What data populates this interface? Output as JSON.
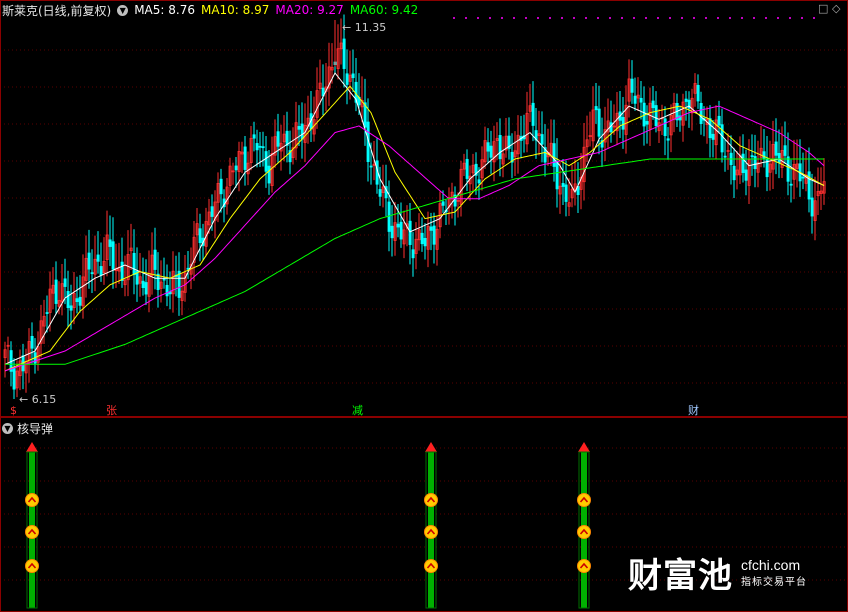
{
  "header": {
    "stock": "斯莱克(日线,前复权)",
    "ma5": "MA5: 8.76",
    "ma10": "MA10: 8.97",
    "ma20": "MA20: 9.27",
    "ma60": "MA60: 9.42"
  },
  "sub_title": "核导弹",
  "corner_icons": [
    "square-icon",
    "diamond-icon"
  ],
  "colors": {
    "up": "#ff3030",
    "down": "#00ffff",
    "ma5": "#ffffff",
    "ma10": "#ffff00",
    "ma20": "#ff00ff",
    "ma60": "#00ff00",
    "missile": "#00b000"
  },
  "chart_data": {
    "type": "candlestick",
    "ylim": [
      5.8,
      11.6
    ],
    "high_label": "11.35",
    "low_label": "6.15",
    "markers": [
      {
        "text": "$",
        "x": 2,
        "color": "#ff3030"
      },
      {
        "text": "张",
        "x": 34,
        "color": "#ff3030"
      },
      {
        "text": "减",
        "x": 116,
        "color": "#00ff00"
      },
      {
        "text": "财",
        "x": 228,
        "color": "#a0c8ff"
      }
    ],
    "missiles": [
      9,
      142,
      193
    ],
    "trend": [
      [
        0,
        6.5
      ],
      [
        3,
        6.3
      ],
      [
        6,
        6.35
      ],
      [
        9,
        6.6
      ],
      [
        12,
        6.9
      ],
      [
        15,
        7.4
      ],
      [
        18,
        7.6
      ],
      [
        22,
        7.2
      ],
      [
        26,
        7.7
      ],
      [
        30,
        7.9
      ],
      [
        34,
        8.1
      ],
      [
        38,
        7.8
      ],
      [
        42,
        7.9
      ],
      [
        46,
        7.6
      ],
      [
        50,
        7.8
      ],
      [
        55,
        7.5
      ],
      [
        60,
        7.7
      ],
      [
        64,
        8.3
      ],
      [
        68,
        8.6
      ],
      [
        72,
        9.0
      ],
      [
        76,
        9.3
      ],
      [
        80,
        9.6
      ],
      [
        84,
        9.7
      ],
      [
        88,
        9.4
      ],
      [
        92,
        9.8
      ],
      [
        96,
        9.7
      ],
      [
        100,
        10.0
      ],
      [
        104,
        10.3
      ],
      [
        107,
        10.7
      ],
      [
        110,
        11.1
      ],
      [
        113,
        10.9
      ],
      [
        116,
        10.7
      ],
      [
        119,
        10.1
      ],
      [
        122,
        9.5
      ],
      [
        125,
        9.0
      ],
      [
        128,
        8.6
      ],
      [
        131,
        8.4
      ],
      [
        134,
        8.3
      ],
      [
        137,
        8.3
      ],
      [
        140,
        8.2
      ],
      [
        143,
        8.5
      ],
      [
        146,
        8.7
      ],
      [
        149,
        8.9
      ],
      [
        152,
        9.2
      ],
      [
        156,
        9.3
      ],
      [
        160,
        9.5
      ],
      [
        164,
        9.8
      ],
      [
        168,
        9.5
      ],
      [
        172,
        9.9
      ],
      [
        176,
        10.1
      ],
      [
        180,
        9.6
      ],
      [
        184,
        9.3
      ],
      [
        186,
        9.0
      ],
      [
        189,
        8.8
      ],
      [
        192,
        9.4
      ],
      [
        196,
        10.1
      ],
      [
        200,
        9.9
      ],
      [
        204,
        10.0
      ],
      [
        208,
        10.5
      ],
      [
        212,
        10.3
      ],
      [
        216,
        10.1
      ],
      [
        220,
        10.0
      ],
      [
        224,
        10.1
      ],
      [
        228,
        10.5
      ],
      [
        232,
        10.2
      ],
      [
        236,
        9.9
      ],
      [
        240,
        9.7
      ],
      [
        244,
        9.2
      ],
      [
        248,
        9.5
      ],
      [
        252,
        9.4
      ],
      [
        256,
        9.6
      ],
      [
        260,
        9.4
      ],
      [
        264,
        9.3
      ],
      [
        268,
        9.0
      ],
      [
        271,
        8.8
      ],
      [
        273,
        9.2
      ]
    ],
    "ma5": [
      [
        0,
        6.4
      ],
      [
        10,
        6.6
      ],
      [
        20,
        7.4
      ],
      [
        30,
        7.7
      ],
      [
        40,
        7.9
      ],
      [
        50,
        7.7
      ],
      [
        60,
        7.7
      ],
      [
        70,
        8.6
      ],
      [
        80,
        9.3
      ],
      [
        90,
        9.6
      ],
      [
        100,
        9.9
      ],
      [
        110,
        10.8
      ],
      [
        117,
        10.4
      ],
      [
        125,
        9.2
      ],
      [
        135,
        8.4
      ],
      [
        145,
        8.6
      ],
      [
        155,
        9.2
      ],
      [
        165,
        9.6
      ],
      [
        175,
        9.9
      ],
      [
        185,
        9.4
      ],
      [
        190,
        9.0
      ],
      [
        198,
        9.8
      ],
      [
        208,
        10.3
      ],
      [
        218,
        10.1
      ],
      [
        228,
        10.3
      ],
      [
        238,
        9.9
      ],
      [
        248,
        9.4
      ],
      [
        258,
        9.5
      ],
      [
        268,
        9.2
      ],
      [
        273,
        9.1
      ]
    ],
    "ma10": [
      [
        0,
        6.3
      ],
      [
        15,
        6.6
      ],
      [
        25,
        7.2
      ],
      [
        35,
        7.6
      ],
      [
        45,
        7.8
      ],
      [
        55,
        7.7
      ],
      [
        65,
        7.9
      ],
      [
        75,
        8.6
      ],
      [
        85,
        9.2
      ],
      [
        95,
        9.6
      ],
      [
        105,
        10.1
      ],
      [
        115,
        10.6
      ],
      [
        122,
        10.2
      ],
      [
        130,
        9.3
      ],
      [
        140,
        8.6
      ],
      [
        150,
        8.7
      ],
      [
        160,
        9.2
      ],
      [
        170,
        9.5
      ],
      [
        180,
        9.6
      ],
      [
        188,
        9.4
      ],
      [
        195,
        9.6
      ],
      [
        205,
        10.0
      ],
      [
        215,
        10.2
      ],
      [
        225,
        10.3
      ],
      [
        235,
        10.1
      ],
      [
        245,
        9.7
      ],
      [
        255,
        9.5
      ],
      [
        265,
        9.3
      ],
      [
        273,
        9.1
      ]
    ],
    "ma20": [
      [
        0,
        6.3
      ],
      [
        20,
        6.6
      ],
      [
        35,
        7.0
      ],
      [
        50,
        7.4
      ],
      [
        60,
        7.6
      ],
      [
        70,
        8.0
      ],
      [
        80,
        8.5
      ],
      [
        90,
        9.0
      ],
      [
        100,
        9.4
      ],
      [
        110,
        9.9
      ],
      [
        118,
        10.0
      ],
      [
        128,
        9.7
      ],
      [
        138,
        9.3
      ],
      [
        148,
        8.9
      ],
      [
        158,
        8.9
      ],
      [
        168,
        9.1
      ],
      [
        178,
        9.4
      ],
      [
        188,
        9.5
      ],
      [
        198,
        9.6
      ],
      [
        208,
        9.8
      ],
      [
        218,
        10.0
      ],
      [
        228,
        10.2
      ],
      [
        238,
        10.3
      ],
      [
        248,
        10.1
      ],
      [
        258,
        9.9
      ],
      [
        268,
        9.6
      ],
      [
        273,
        9.4
      ]
    ],
    "ma60": [
      [
        0,
        6.4
      ],
      [
        20,
        6.4
      ],
      [
        40,
        6.7
      ],
      [
        60,
        7.1
      ],
      [
        80,
        7.5
      ],
      [
        95,
        7.9
      ],
      [
        110,
        8.3
      ],
      [
        125,
        8.6
      ],
      [
        140,
        8.8
      ],
      [
        155,
        9.0
      ],
      [
        170,
        9.2
      ],
      [
        185,
        9.3
      ],
      [
        200,
        9.4
      ],
      [
        215,
        9.5
      ],
      [
        230,
        9.5
      ],
      [
        245,
        9.5
      ],
      [
        260,
        9.5
      ],
      [
        273,
        9.5
      ]
    ]
  },
  "watermark": {
    "brand": "财富池",
    "site": "cfchi.com",
    "tagline": "指标交易平台"
  }
}
